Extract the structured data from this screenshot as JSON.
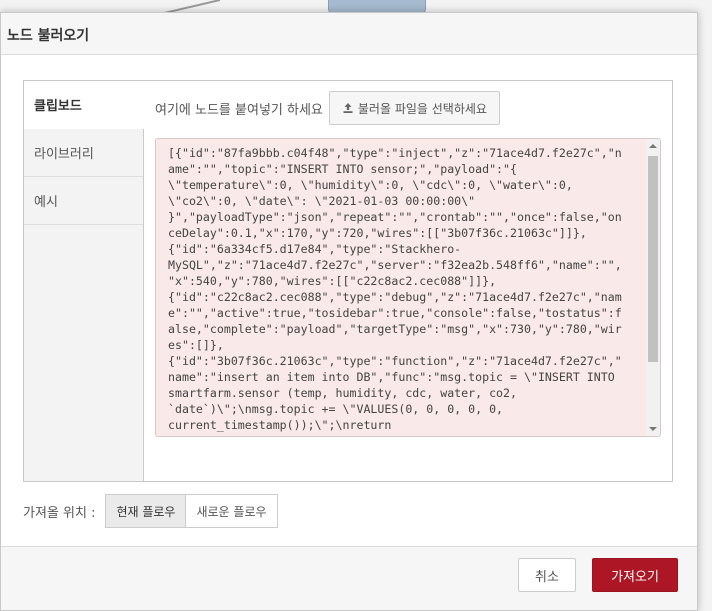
{
  "dialog": {
    "title": "노드 불러오기"
  },
  "tabs": [
    {
      "label": "클립보드",
      "active": true
    },
    {
      "label": "라이브러리",
      "active": false
    },
    {
      "label": "예시",
      "active": false
    }
  ],
  "clipboard": {
    "paste_label": "여기에 노드를 붙여넣기 하세요",
    "file_button_label": "불러올 파일을 선택하세요",
    "file_button_icon": "upload-icon",
    "code_lines": [
      "[{\"id\":\"87fa9bbb.c04f48\",\"type\":\"inject\",\"z\":\"71ace4d7.f2e27c\",\"n",
      "ame\":\"\",\"topic\":\"INSERT INTO sensor;\",\"payload\":\"{",
      "\\\"temperature\\\":0, \\\"humidity\\\":0, \\\"cdc\\\":0, \\\"water\\\":0,",
      "\\\"co2\\\":0, \\\"date\\\": \\\"2021-01-03 00:00:00\\\"",
      "}\",\"payloadType\":\"json\",\"repeat\":\"\",\"crontab\":\"\",\"once\":false,\"on",
      "ceDelay\":0.1,\"x\":170,\"y\":720,\"wires\":[[\"3b07f36c.21063c\"]]},",
      "{\"id\":\"6a334cf5.d17e84\",\"type\":\"Stackhero-",
      "MySQL\",\"z\":\"71ace4d7.f2e27c\",\"server\":\"f32ea2b.548ff6\",\"name\":\"\",",
      "\"x\":540,\"y\":780,\"wires\":[[\"c22c8ac2.cec088\"]]},",
      "{\"id\":\"c22c8ac2.cec088\",\"type\":\"debug\",\"z\":\"71ace4d7.f2e27c\",\"nam",
      "e\":\"\",\"active\":true,\"tosidebar\":true,\"console\":false,\"tostatus\":f",
      "alse,\"complete\":\"payload\",\"targetType\":\"msg\",\"x\":730,\"y\":780,\"wir",
      "es\":[]},",
      "{\"id\":\"3b07f36c.21063c\",\"type\":\"function\",\"z\":\"71ace4d7.f2e27c\",\"",
      "name\":\"insert an item into DB\",\"func\":\"msg.topic = \\\"INSERT INTO",
      "smartfarm.sensor (temp, humidity, cdc, water, co2,",
      "`date`)\\\";\\nmsg.topic += \\\"VALUES(0, 0, 0, 0, 0,",
      "current_timestamp());\\\";\\nreturn"
    ]
  },
  "import_target": {
    "label": "가져올 위치 :",
    "options": [
      {
        "label": "현재 플로우",
        "selected": true
      },
      {
        "label": "새로운 플로우",
        "selected": false
      }
    ]
  },
  "footer": {
    "cancel_label": "취소",
    "import_label": "가져오기"
  }
}
